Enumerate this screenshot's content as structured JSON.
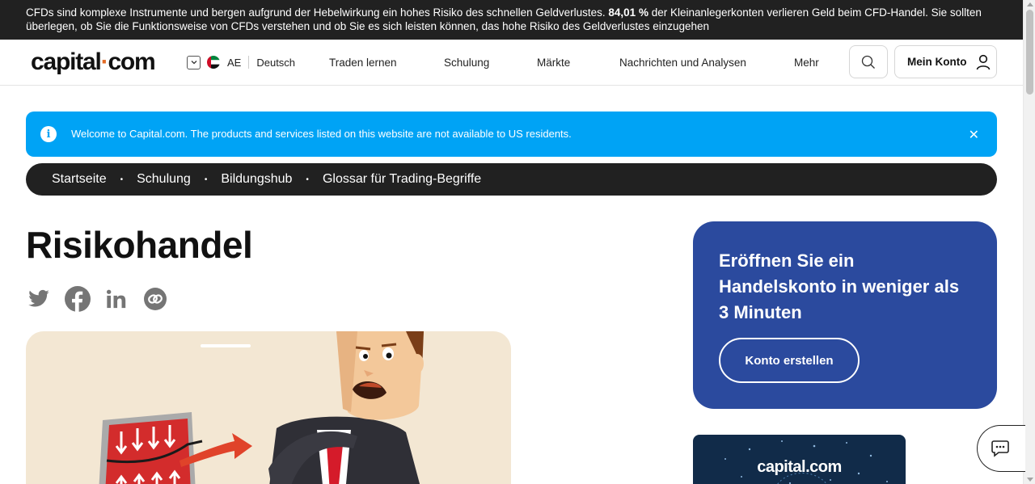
{
  "risk_banner": {
    "text_before": "CFDs sind komplexe Instrumente und bergen aufgrund der Hebelwirkung ein hohes Risiko des schnellen Geldverlustes.",
    "percent": "84,01 %",
    "text_after": "der Kleinanlegerkonten verlieren Geld beim CFD-Handel. Sie sollten überlegen, ob Sie die Funktionsweise von CFDs verstehen und ob Sie es sich leisten können, das hohe Risiko des Geldverlustes einzugehen"
  },
  "header": {
    "logo_left": "capital",
    "logo_dot": "·",
    "logo_right": "com",
    "region": "AE",
    "language": "Deutsch",
    "nav": [
      "Traden lernen",
      "Schulung",
      "Märkte",
      "Nachrichten und Analysen",
      "Mehr"
    ],
    "account_label": "Mein Konto"
  },
  "info_banner": {
    "icon": "i",
    "text": "Welcome to Capital.com. The products and services listed on this website are not available to US residents.",
    "close": "✕"
  },
  "breadcrumb": {
    "items": [
      "Startseite",
      "Schulung",
      "Bildungshub",
      "Glossar für Trading-Begriffe"
    ],
    "separator": "•"
  },
  "page": {
    "title": "Risikohandel"
  },
  "promo": {
    "title": "Eröffnen Sie ein Handelskonto in weniger als 3 Minuten",
    "button": "Konto erstellen"
  },
  "dark_card": {
    "logo": "capital.com"
  },
  "colors": {
    "risk_bg": "#212121",
    "info_bg": "#00a3f5",
    "promo_bg": "#2b4a9e",
    "logo_accent": "#e26b26"
  },
  "icons": [
    "chevron-down-icon",
    "uae-flag-icon",
    "search-icon",
    "user-icon",
    "info-icon",
    "close-icon",
    "twitter-icon",
    "facebook-icon",
    "linkedin-icon",
    "link-icon",
    "chat-icon"
  ]
}
